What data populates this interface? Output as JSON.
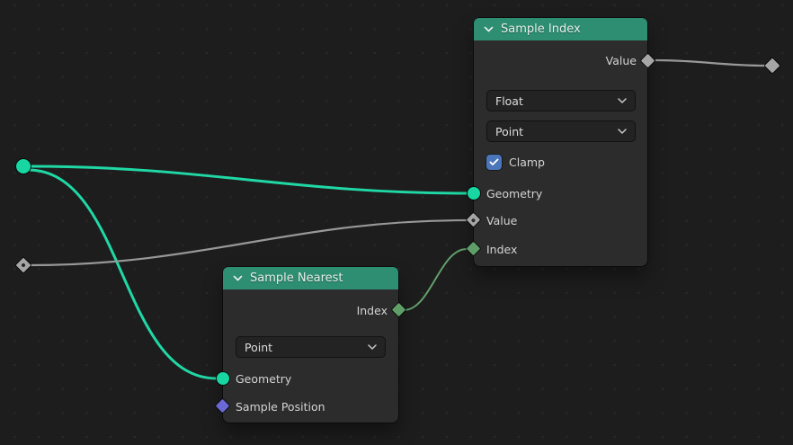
{
  "editor": {
    "background": "#1d1d1d",
    "grid_dot_color": "#2a2a2a"
  },
  "colors": {
    "node_body": "#2c2c2c",
    "node_header": "#2e8e72",
    "header_text": "#e7eeea",
    "label_text": "#d3d3d3",
    "dropdown_bg": "#232323",
    "checkbox_blue": "#4b76b9",
    "socket_geometry": "#17d6a2",
    "socket_integer": "#5f9e68",
    "socket_vector": "#6a68d4",
    "socket_value": "#a6a6a6",
    "wire_geometry": "#20d8a5",
    "wire_integer": "#63a06c",
    "wire_value": "#989898"
  },
  "icons": {
    "collapse_chevron": "⌄",
    "dropdown_chevron": "⌄",
    "checkbox_check": "✓"
  },
  "nodes": {
    "sample_index": {
      "title": "Sample Index",
      "output_value_label": "Value",
      "data_type_dropdown_value": "Float",
      "domain_dropdown_value": "Point",
      "clamp_label": "Clamp",
      "clamp_checked": true,
      "input_geometry_label": "Geometry",
      "input_value_label": "Value",
      "input_index_label": "Index"
    },
    "sample_nearest": {
      "title": "Sample Nearest",
      "output_index_label": "Index",
      "domain_dropdown_value": "Point",
      "input_geometry_label": "Geometry",
      "input_sample_position_label": "Sample Position"
    }
  },
  "floating_sockets": [
    {
      "id": "left-geometry",
      "type": "geometry",
      "shape": "circle"
    },
    {
      "id": "left-value",
      "type": "value-field",
      "shape": "diamond-dot"
    },
    {
      "id": "right-value",
      "type": "value-field",
      "shape": "diamond"
    }
  ],
  "wires": [
    {
      "from": "left-geometry",
      "to": "sample_index.geometry",
      "color_key": "wire_geometry"
    },
    {
      "from": "left-geometry",
      "to": "sample_nearest.geometry",
      "color_key": "wire_geometry"
    },
    {
      "from": "left-value",
      "to": "sample_index.value",
      "color_key": "wire_value"
    },
    {
      "from": "sample_nearest.index",
      "to": "sample_index.index",
      "color_key": "wire_integer"
    },
    {
      "from": "sample_index.value_out",
      "to": "right-value",
      "color_key": "wire_value"
    }
  ]
}
